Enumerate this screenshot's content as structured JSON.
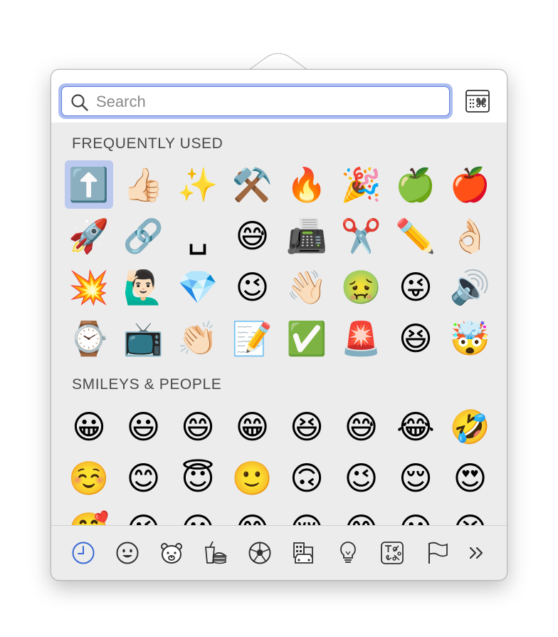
{
  "search": {
    "placeholder": "Search"
  },
  "sections": [
    {
      "title": "FREQUENTLY USED"
    },
    {
      "title": "SMILEYS & PEOPLE"
    }
  ],
  "frequently_used": [
    "⬆️",
    "👍🏻",
    "✨",
    "⚒️",
    "🔥",
    "🎉",
    "🍏",
    "🍎",
    "🚀",
    "🔗",
    "␣",
    "😅",
    "📠",
    "✂️",
    "✏️",
    "👌🏻",
    "💥",
    "🙋🏻‍♂️",
    "💎",
    "😉",
    "👋🏻",
    "🤢",
    "😜",
    "🔊",
    "⌚",
    "📺",
    "👏🏻",
    "📝",
    "✅",
    "🚨",
    "😆",
    "🤯"
  ],
  "smileys_people": [
    "😀",
    "😃",
    "😄",
    "😁",
    "😆",
    "😅",
    "😂",
    "🤣",
    "☺️",
    "😊",
    "😇",
    "🙂",
    "🙃",
    "😉",
    "😌",
    "😍",
    "🥰",
    "😘",
    "😗",
    "😙",
    "😚",
    "😋",
    "😛",
    "😝"
  ],
  "selected_emoji_index": 0,
  "categories": [
    "recent-icon",
    "smiley-icon",
    "animal-icon",
    "food-icon",
    "ball-icon",
    "travel-icon",
    "bulb-icon",
    "symbols-icon",
    "flag-icon",
    "more-icon"
  ],
  "active_category": "recent-icon",
  "colors": {
    "accent": "#3a6ad6",
    "selection": "#bcc9ef",
    "focus_ring": "#adbdf0"
  }
}
